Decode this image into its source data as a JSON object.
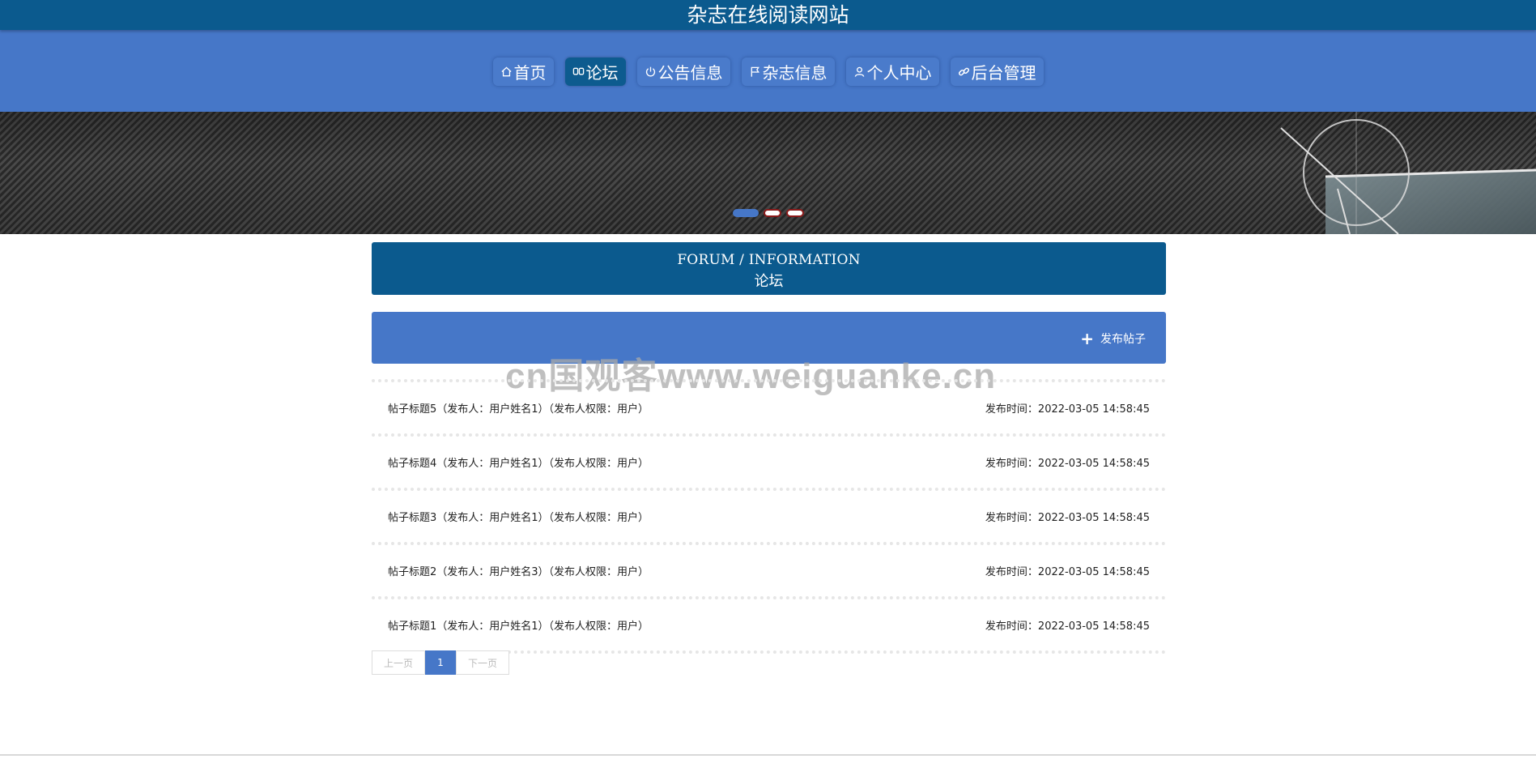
{
  "site": {
    "title": "杂志在线阅读网站"
  },
  "nav": {
    "items": [
      {
        "label": "首页",
        "icon": "home-icon"
      },
      {
        "label": "论坛",
        "icon": "chat-icon",
        "active": true
      },
      {
        "label": "公告信息",
        "icon": "power-icon"
      },
      {
        "label": "杂志信息",
        "icon": "flag-icon"
      },
      {
        "label": "个人中心",
        "icon": "user-icon"
      },
      {
        "label": "后台管理",
        "icon": "link-icon"
      }
    ]
  },
  "section": {
    "en_title": "FORUM / INFORMATION",
    "cn_title": "论坛"
  },
  "toolbar": {
    "publish_label": "发布帖子",
    "publish_icon": "plus-icon"
  },
  "watermark": "cn国观客www.weiguanke.cn",
  "posts": [
    {
      "title": "帖子标题5（发布人：用户姓名1）（发布人权限：用户）",
      "time": "发布时间：2022-03-05 14:58:45"
    },
    {
      "title": "帖子标题4（发布人：用户姓名1）（发布人权限：用户）",
      "time": "发布时间：2022-03-05 14:58:45"
    },
    {
      "title": "帖子标题3（发布人：用户姓名1）（发布人权限：用户）",
      "time": "发布时间：2022-03-05 14:58:45"
    },
    {
      "title": "帖子标题2（发布人：用户姓名3）（发布人权限：用户）",
      "time": "发布时间：2022-03-05 14:58:45"
    },
    {
      "title": "帖子标题1（发布人：用户姓名1）（发布人权限：用户）",
      "time": "发布时间：2022-03-05 14:58:45"
    }
  ],
  "pagination": {
    "prev": "上一页",
    "current": "1",
    "next": "下一页"
  },
  "colors": {
    "primary_dark": "#0b5a8e",
    "primary": "#4677c8",
    "dot_border": "#8b1a1a"
  }
}
